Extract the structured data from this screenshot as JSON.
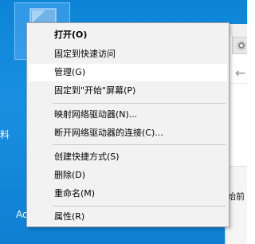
{
  "desktop": {
    "side_label_left": "料",
    "side_label_ac": "Ac"
  },
  "background_window": {
    "ribbon_tab_icon": "gear-icon",
    "nav_arrow": "←",
    "pane_text": "始前"
  },
  "context_menu": {
    "items": [
      {
        "label": "打开(O)"
      },
      {
        "label": "固定到快速访问"
      },
      {
        "label": "管理(G)"
      },
      {
        "label": "固定到\"开始\"屏幕(P)"
      },
      {
        "label": "映射网络驱动器(N)..."
      },
      {
        "label": "断开网络驱动器的连接(C)..."
      },
      {
        "label": "创建快捷方式(S)"
      },
      {
        "label": "删除(D)"
      },
      {
        "label": "重命名(M)"
      },
      {
        "label": "属性(R)"
      }
    ]
  },
  "colors": {
    "desktop_blue": "#0b84d8",
    "menu_bg": "#f2f2f2",
    "menu_highlight": "#ffffff",
    "separator": "#c8c8c8"
  }
}
